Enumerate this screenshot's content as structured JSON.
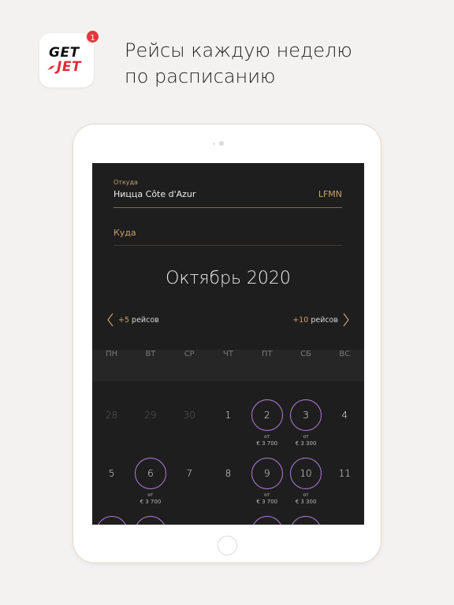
{
  "header": {
    "logo_top": "GET",
    "logo_bottom": "JET",
    "badge_count": "1",
    "headline_line1": "Рейсы каждую неделю",
    "headline_line2": "по расписанию"
  },
  "form": {
    "from_label": "Откуда",
    "from_value": "Ницца Côte d'Azur",
    "from_code": "LFMN",
    "to_placeholder": "Куда"
  },
  "calendar": {
    "month_title": "Октябрь 2020",
    "prev": {
      "count": "+5",
      "text": "рейсов"
    },
    "next": {
      "count": "+10",
      "text": "рейсов"
    },
    "weekdays": [
      "ПН",
      "ВТ",
      "СР",
      "ЧТ",
      "ПТ",
      "СБ",
      "ВС"
    ],
    "weeks": [
      [
        {
          "n": "28",
          "muted": true
        },
        {
          "n": "29",
          "muted": true
        },
        {
          "n": "30",
          "muted": true
        },
        {
          "n": "1"
        },
        {
          "n": "2",
          "flight": true,
          "from": "от",
          "price": "€ 3 700"
        },
        {
          "n": "3",
          "flight": true,
          "from": "от",
          "price": "€ 3 300"
        },
        {
          "n": "4"
        }
      ],
      [
        {
          "n": "5"
        },
        {
          "n": "6",
          "flight": true,
          "from": "от",
          "price": "€ 3 700"
        },
        {
          "n": "7"
        },
        {
          "n": "8"
        },
        {
          "n": "9",
          "flight": true,
          "from": "от",
          "price": "€ 3 700"
        },
        {
          "n": "10",
          "flight": true,
          "from": "от",
          "price": "€ 3 300"
        },
        {
          "n": "11"
        }
      ],
      [
        {
          "n": "",
          "flight": true
        },
        {
          "n": "",
          "flight": true
        },
        {
          "n": ""
        },
        {
          "n": ""
        },
        {
          "n": "",
          "flight": true
        },
        {
          "n": "",
          "flight": true
        },
        {
          "n": ""
        }
      ]
    ]
  },
  "colors": {
    "accent_gold": "#c7a06a",
    "flight_ring": "#b27bdc",
    "badge_red": "#e8363e",
    "screen_bg": "#1f1e1e"
  }
}
